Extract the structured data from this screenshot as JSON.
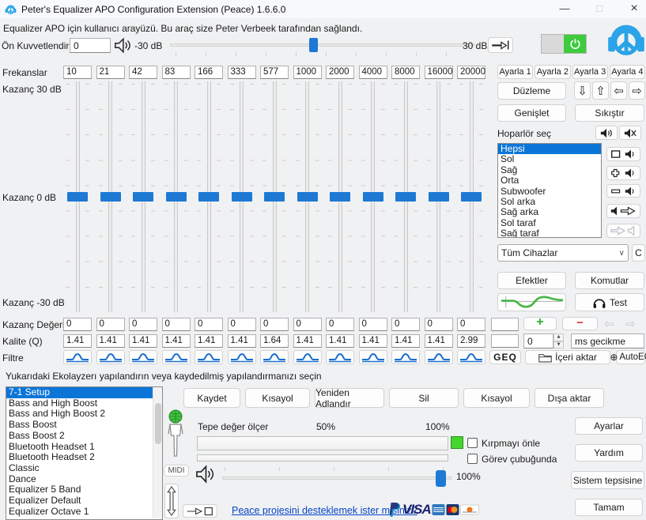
{
  "window": {
    "title": "Peter's Equalizer APO Configuration Extension (Peace) 1.6.6.0",
    "minimize": "—",
    "maximize": "□",
    "close": "×"
  },
  "header": {
    "subtitle": "Equalizer APO için kullanıcı arayüzü. Bu araç size Peter Verbeek tarafından sağlandı.",
    "preamp_label": "Ön Kuvvetlendirme",
    "preamp_value": "0",
    "slider_min": "-30 dB",
    "slider_max": "30 dB"
  },
  "eq": {
    "row_labels": {
      "frequencies": "Frekanslar",
      "gain_top": "Kazanç 30 dB",
      "gain_mid": "Kazanç 0 dB",
      "gain_bottom": "Kazanç -30 dB",
      "gain_value": "Kazanç Değeri",
      "quality": "Kalite (Q)",
      "filter": "Filtre"
    },
    "bands": [
      {
        "freq": "10",
        "gain": "0",
        "q": "1.41"
      },
      {
        "freq": "21",
        "gain": "0",
        "q": "1.41"
      },
      {
        "freq": "42",
        "gain": "0",
        "q": "1.41"
      },
      {
        "freq": "83",
        "gain": "0",
        "q": "1.41"
      },
      {
        "freq": "166",
        "gain": "0",
        "q": "1.41"
      },
      {
        "freq": "333",
        "gain": "0",
        "q": "1.41"
      },
      {
        "freq": "577",
        "gain": "0",
        "q": "1.64"
      },
      {
        "freq": "1000",
        "gain": "0",
        "q": "1.41"
      },
      {
        "freq": "2000",
        "gain": "0",
        "q": "1.41"
      },
      {
        "freq": "4000",
        "gain": "0",
        "q": "1.41"
      },
      {
        "freq": "8000",
        "gain": "0",
        "q": "1.41"
      },
      {
        "freq": "16000",
        "gain": "0",
        "q": "1.41"
      },
      {
        "freq": "20000",
        "gain": "0",
        "q": "2.99"
      }
    ]
  },
  "right_panel": {
    "set_buttons": [
      "Ayarla 1",
      "Ayarla 2",
      "Ayarla 3",
      "Ayarla 4"
    ],
    "flatten": "Düzleme",
    "widen": "Genişlet",
    "compress": "Sıkıştır",
    "speaker_select_label": "Hoparlör seç",
    "speakers": [
      {
        "label": "Hepsi",
        "selected": true
      },
      {
        "label": "Sol"
      },
      {
        "label": "Sağ"
      },
      {
        "label": "Orta"
      },
      {
        "label": "Subwoofer"
      },
      {
        "label": "Sol arka"
      },
      {
        "label": "Sağ arka"
      },
      {
        "label": "Sol taraf"
      },
      {
        "label": "Sağ taraf"
      }
    ],
    "device_dropdown": "Tüm Cihazlar",
    "device_c": "C",
    "effects": "Efektler",
    "commands": "Komutlar",
    "test": "Test",
    "delay_value": "0",
    "delay_unit": "ms gecikme",
    "geq": "GEQ",
    "import": "İçeri aktar",
    "autoeq": "AutoEQ"
  },
  "presets": {
    "instruction": "Yukarıdaki Ekolayzerı yapılandırın veya kaydedilmiş yapılandırmanızı seçin",
    "items": [
      {
        "label": "7-1 Setup",
        "selected": true
      },
      {
        "label": "Bass and High Boost"
      },
      {
        "label": "Bass and High Boost 2"
      },
      {
        "label": "Bass Boost"
      },
      {
        "label": "Bass Boost 2"
      },
      {
        "label": "Bluetooth Headset 1"
      },
      {
        "label": "Bluetooth Headset 2"
      },
      {
        "label": "Classic"
      },
      {
        "label": "Dance"
      },
      {
        "label": "Equalizer 5 Band"
      },
      {
        "label": "Equalizer Default"
      },
      {
        "label": "Equalizer Octave 1"
      }
    ],
    "buttons": [
      "Kaydet",
      "Kısayol",
      "Yeniden Adlandır",
      "Sil",
      "Kısayol",
      "Dışa aktar"
    ]
  },
  "bottom": {
    "midi": "MIDI",
    "peak_label": "Tepe değer ölçer",
    "p50": "50%",
    "p100": "100%",
    "clip_checkbox": "Kırpmayı önle",
    "taskbar_checkbox": "Görev çubuğunda",
    "volume_value": "100%",
    "donate_link": "Peace projesini desteklemek ister misiniz?",
    "visa": "VISA",
    "buttons": {
      "settings": "Ayarlar",
      "help": "Yardım",
      "tray": "Sistem tepsisine",
      "ok": "Tamam"
    }
  },
  "icons": {
    "arrow_down": "⇩",
    "arrow_up": "⇧",
    "arrow_left": "⇦",
    "arrow_right": "⇨",
    "chevron_down": "∨",
    "spin_up": "▲",
    "spin_down": "▼",
    "plus": "+",
    "minus": "−",
    "globe": "⊕"
  },
  "colors": {
    "accent_blue": "#1d79d3",
    "logo_blue": "#2aa3e8",
    "power_green": "#3ecb3e",
    "selection_blue": "#0b76d8",
    "plus_green": "#2fae2f",
    "minus_red": "#d93434"
  }
}
